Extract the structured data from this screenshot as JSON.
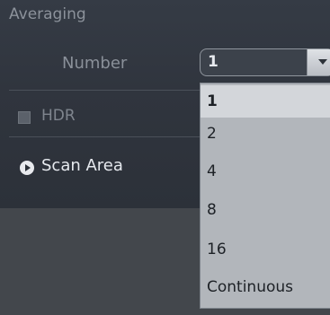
{
  "section": {
    "title": "Averaging"
  },
  "number": {
    "label": "Number",
    "selected_value": "1",
    "options": [
      "1",
      "2",
      "4",
      "8",
      "16",
      "Continuous"
    ]
  },
  "hdr": {
    "label": "HDR",
    "checked": false
  },
  "scan_area": {
    "label": "Scan Area"
  },
  "colors": {
    "panel_bg": "#30353e",
    "dropdown_bg": "#b2b6bb",
    "selected_option_bg": "#d3d6da",
    "text_light": "#e6e9ee",
    "text_muted": "#8a9099"
  },
  "icons": {
    "scan_area": "play-circle-icon",
    "number_select": "chevron-down-icon"
  }
}
